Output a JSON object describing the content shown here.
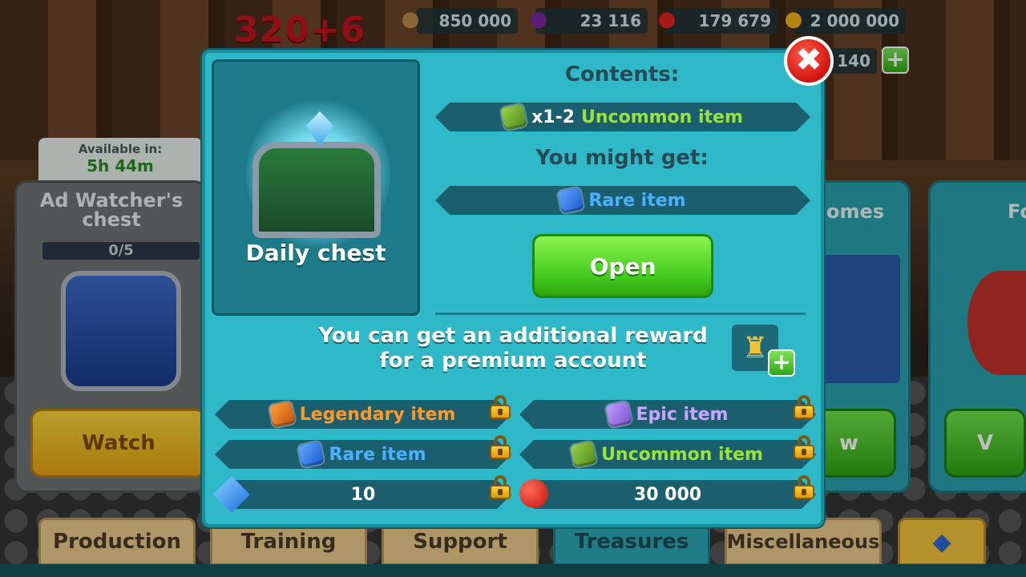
{
  "top_bar": {
    "level": "320+6",
    "resources": [
      {
        "icon": "wood-log-icon",
        "value": "850 000"
      },
      {
        "icon": "eggplant-icon",
        "value": "23 116"
      },
      {
        "icon": "apple-icon",
        "value": "179 679"
      },
      {
        "icon": "gold-coin-icon",
        "value": "2 000 000"
      }
    ],
    "gems_value": "140"
  },
  "left_card": {
    "available_label": "Available in:",
    "available_time": "5h 44m",
    "title": "Ad Watcher's chest",
    "progress": "0/5",
    "progress_fraction": 0,
    "button": "Watch"
  },
  "right_cards": {
    "card1_title_partial": "omes",
    "card1_button_partial": "w",
    "card2_title_partial": "Fo",
    "card2_button_partial": "V"
  },
  "modal": {
    "chest_name": "Daily chest",
    "contents_title": "Contents:",
    "contents_item_qty": "x1-2",
    "contents_item_name": "Uncommon item",
    "might_get_title": "You might get:",
    "might_get_item": "Rare item",
    "open_button": "Open",
    "premium_text": "You can get an additional reward for a premium account",
    "premium_rewards": [
      {
        "name": "Legendary item",
        "rarity": "legendary",
        "locked": true
      },
      {
        "name": "Epic item",
        "rarity": "epic",
        "locked": true
      },
      {
        "name": "Rare item",
        "rarity": "rare",
        "locked": true
      },
      {
        "name": "Uncommon item",
        "rarity": "uncommon",
        "locked": true
      }
    ],
    "premium_resources": [
      {
        "icon": "blue-crystal-icon",
        "value": "10",
        "locked": true
      },
      {
        "icon": "apple-icon",
        "value": "30 000",
        "locked": true
      }
    ]
  },
  "tabs": [
    {
      "label": "Production",
      "active": false
    },
    {
      "label": "Training",
      "active": false
    },
    {
      "label": "Support",
      "active": false
    },
    {
      "label": "Treasures",
      "active": true
    },
    {
      "label": "Miscellaneous",
      "active": false
    }
  ],
  "colors": {
    "modal_bg": "#2fb9c8",
    "legendary": "#ff9a2a",
    "epic": "#c8a6ff",
    "rare": "#4ab2ff",
    "uncommon": "#9be23a",
    "open_button": "#41c81c",
    "close_button": "#d2140e"
  }
}
